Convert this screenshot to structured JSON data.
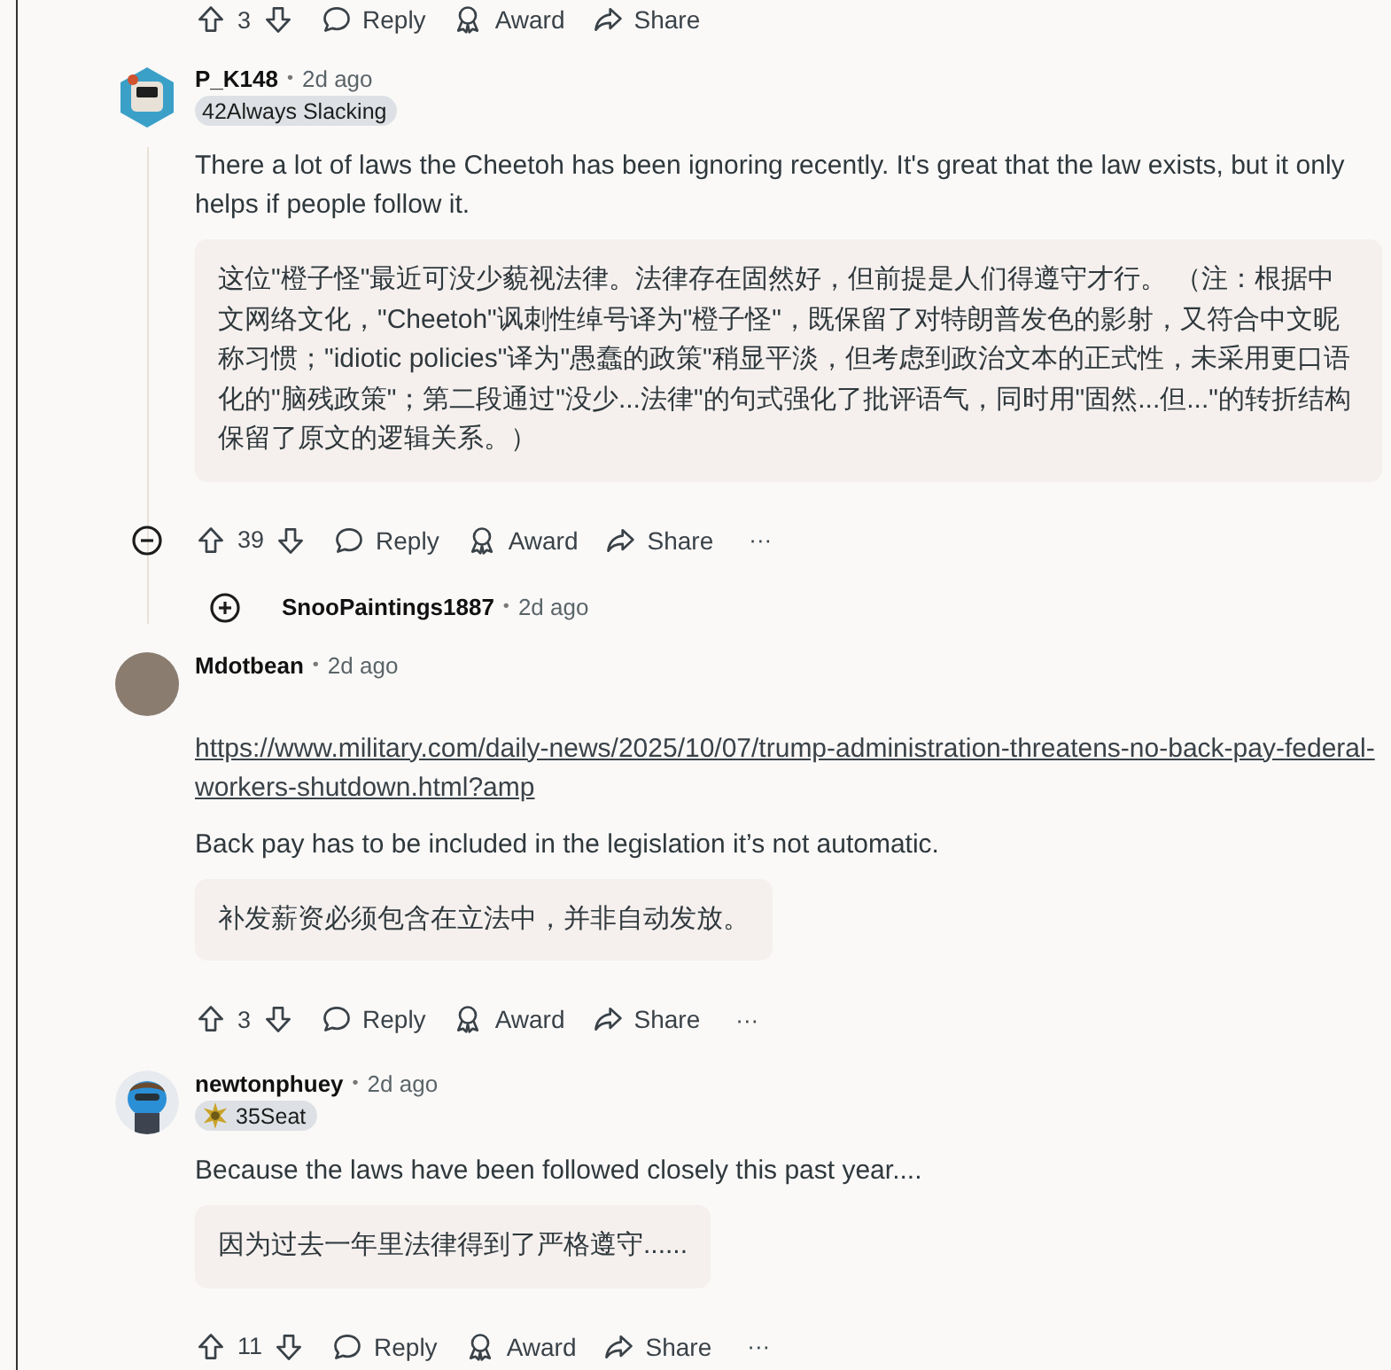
{
  "previous_actions": {
    "score": "3",
    "reply": "Reply",
    "award": "Award",
    "share": "Share"
  },
  "comments": [
    {
      "author": "P_K148",
      "separator": "•",
      "time": "2d ago",
      "avatar": {
        "kind": "robot"
      },
      "flair": {
        "text": "42Always Slacking",
        "icon": false
      },
      "body": "There a lot of laws the Cheetoh has been ignoring recently. It's great that the law exists, but it only helps if people follow it.",
      "translation": "这位\"橙子怪\"最近可没少藐视法律。法律存在固然好，但前提是人们得遵守才行。 （注：根据中文网络文化，\"Cheetoh\"讽刺性绰号译为\"橙子怪\"，既保留了对特朗普发色的影射，又符合中文昵称习惯；\"idiotic policies\"译为\"愚蠢的政策\"稍显平淡，但考虑到政治文本的正式性，未采用更口语化的\"脑残政策\"；第二段通过\"没少...法律\"的句式强化了批评语气，同时用\"固然...但...\"的转折结构保留了原文的逻辑关系。）",
      "score": "39",
      "reply": "Reply",
      "award": "Award",
      "share": "Share",
      "more": "···",
      "replies": [
        {
          "author": "SnooPaintings1887",
          "separator": "•",
          "time": "2d ago",
          "expanded": false
        }
      ]
    },
    {
      "author": "Mdotbean",
      "separator": "•",
      "time": "2d ago",
      "avatar": {
        "kind": "photo"
      },
      "link": "https://www.military.com/daily-news/2025/10/07/trump-administration-threatens-no-back-pay-federal-workers-shutdown.html?amp",
      "body": "Back pay has to be included in the legislation it’s not automatic.",
      "translation": "补发薪资必须包含在立法中，并非自动发放。",
      "score": "3",
      "reply": "Reply",
      "award": "Award",
      "share": "Share",
      "more": "···"
    },
    {
      "author": "newtonphuey",
      "separator": "•",
      "time": "2d ago",
      "avatar": {
        "kind": "snoo"
      },
      "flair": {
        "text": "35Seat",
        "icon": true
      },
      "body": "Because the laws have been followed closely this past year....",
      "translation": "因为过去一年里法律得到了严格遵守......",
      "score": "11",
      "reply": "Reply",
      "award": "Award",
      "share": "Share",
      "more": "···"
    }
  ]
}
